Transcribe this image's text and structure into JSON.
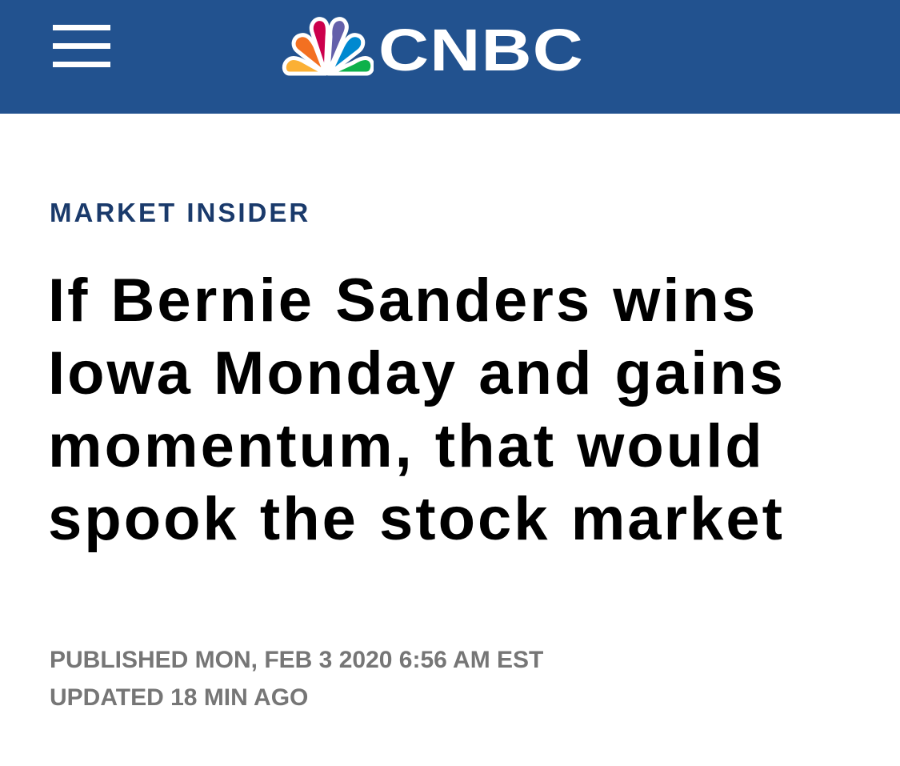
{
  "header": {
    "brand": "CNBC",
    "background_color": "#22528f",
    "menu_icon": "hamburger-menu-icon",
    "logo_icon": "nbc-peacock-icon",
    "peacock_colors": [
      "#fbb034",
      "#f37021",
      "#cc004c",
      "#6460aa",
      "#0089d0",
      "#0db14b"
    ]
  },
  "article": {
    "kicker": "MARKET INSIDER",
    "kicker_color": "#1a3a6b",
    "headline": "If Bernie Sanders wins Iowa Monday and gains momentum, that would spook the stock market",
    "published": "PUBLISHED MON, FEB 3 2020 6:56 AM EST",
    "updated": "UPDATED 18 MIN AGO",
    "meta_color": "#767676"
  }
}
